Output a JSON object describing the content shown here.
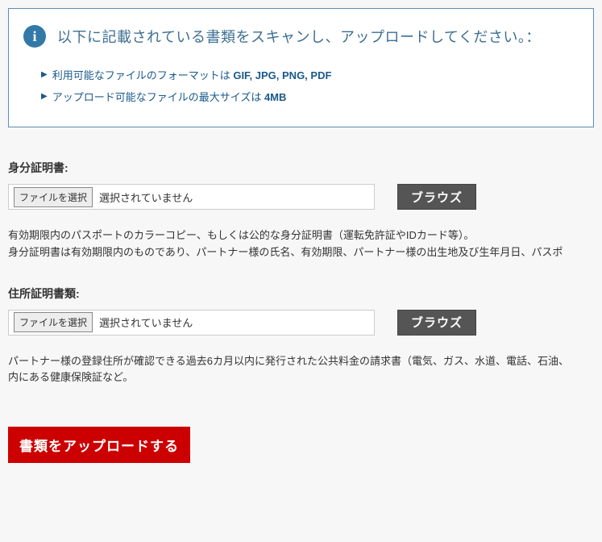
{
  "info": {
    "icon_glyph": "i",
    "title": "以下に記載されている書類をスキャンし、アップロードしてください。：",
    "items": [
      {
        "prefix": "利用可能なファイルのフォーマットは ",
        "bold": "GIF, JPG, PNG, PDF"
      },
      {
        "prefix": "アップロード可能なファイルの最大サイズは ",
        "bold": "4MB"
      }
    ]
  },
  "sections": {
    "id": {
      "label": "身分証明書:",
      "choose_label": "ファイルを選択",
      "status": "選択されていません",
      "browse": "ブラウズ",
      "desc_line1": "有効期限内のパスポートのカラーコピー、もしくは公的な身分証明書（運転免許証やIDカード等）。",
      "desc_line2": "身分証明書は有効期限内のものであり、パートナー様の氏名、有効期限、パートナー様の出生地及び生年月日、パスポ"
    },
    "address": {
      "label": "住所証明書類:",
      "choose_label": "ファイルを選択",
      "status": "選択されていません",
      "browse": "ブラウズ",
      "desc_line1": "パートナー様の登録住所が確認できる過去6カ月以内に発行された公共料金の請求書（電気、ガス、水道、電話、石油、",
      "desc_line2": "内にある健康保険証など。"
    }
  },
  "upload_button": "書類をアップロードする"
}
